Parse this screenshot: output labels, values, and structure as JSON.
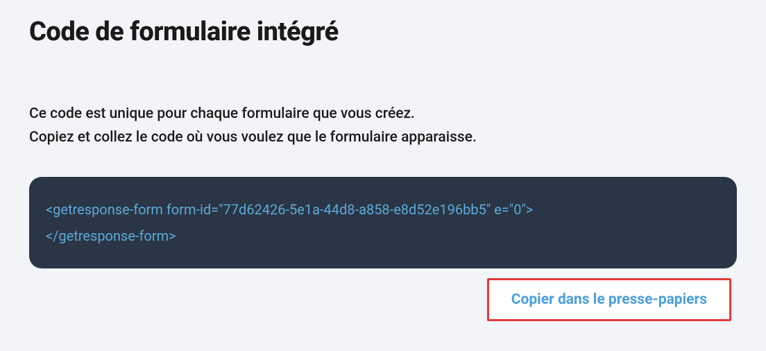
{
  "header": {
    "title": "Code de formulaire intégré"
  },
  "description": {
    "line1": "Ce code est unique pour chaque formulaire que vous créez.",
    "line2": "Copiez et collez le code où vous voulez que le formulaire apparaisse."
  },
  "code": {
    "open_tag": "<getresponse-form form-id=\"77d62426-5e1a-44d8-a858-e8d52e196bb5\" e=\"0\">",
    "close_tag": "</getresponse-form>"
  },
  "actions": {
    "copy_label": "Copier dans le presse-papiers"
  }
}
